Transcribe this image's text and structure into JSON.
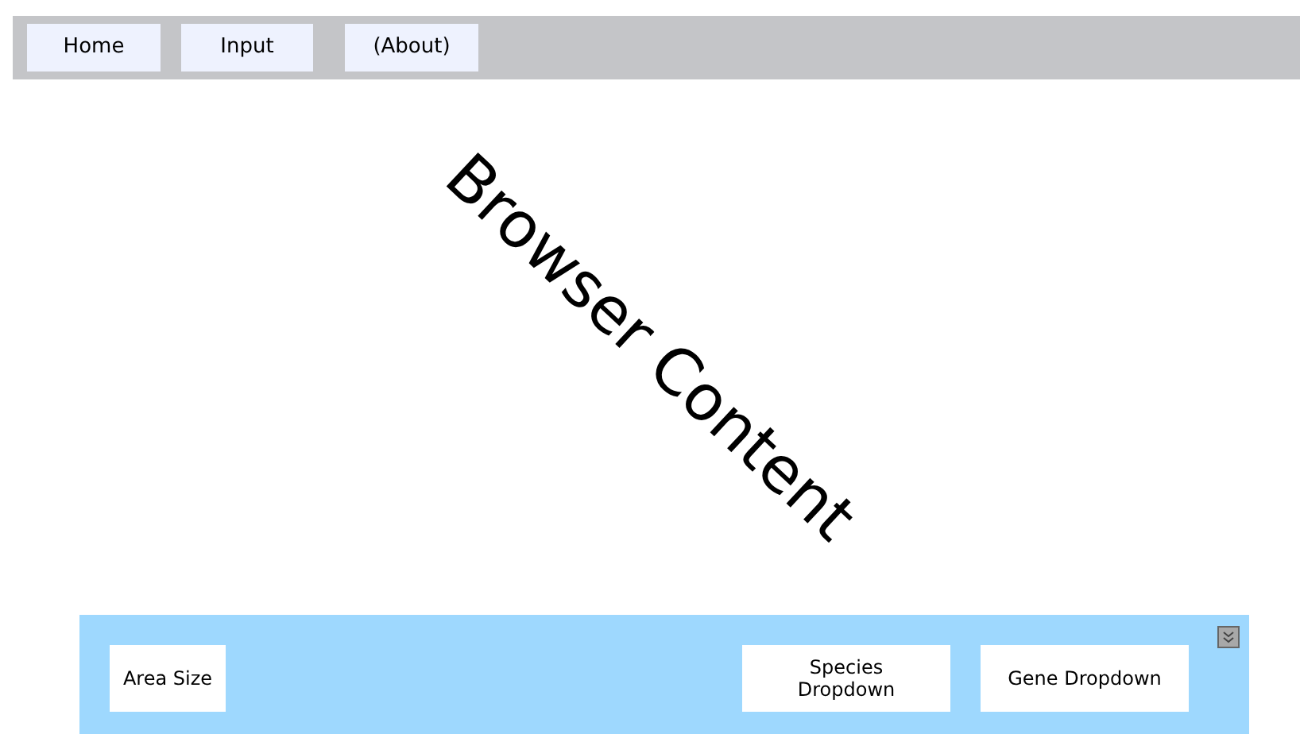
{
  "nav": {
    "items": [
      {
        "label": "Home"
      },
      {
        "label": "Input"
      },
      {
        "label": "(About)"
      }
    ]
  },
  "content": {
    "label": "Browser Content"
  },
  "panel": {
    "controls": [
      {
        "label": "Area Size"
      },
      {
        "label": "Species Dropdown"
      },
      {
        "label": "Gene Dropdown"
      }
    ]
  }
}
